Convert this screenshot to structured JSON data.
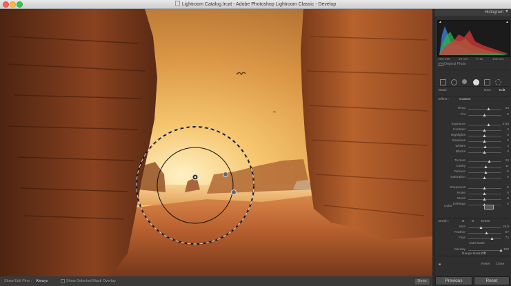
{
  "window": {
    "title": "Lightroom Catalog.lrcat - Adobe Photoshop Lightroom Classic - Develop"
  },
  "histogram": {
    "header": "Histogram",
    "iso": "ISO 100",
    "focal": "18 mm",
    "aperture": "f / 16",
    "shutter": "1/30 sec",
    "original_photo": "Original Photo"
  },
  "mask": {
    "label": "Mask :",
    "new": "New",
    "edit": "Edit"
  },
  "effect": {
    "label": "Effect :",
    "value": "Custom"
  },
  "sliders": [
    {
      "label": "Temp",
      "value": "13",
      "pos": 0.62
    },
    {
      "label": "Tint",
      "value": "0",
      "pos": 0.5
    },
    {
      "label": "Exposure",
      "value": "0.85",
      "pos": 0.62
    },
    {
      "label": "Contrast",
      "value": "0",
      "pos": 0.5
    },
    {
      "label": "Highlights",
      "value": "0",
      "pos": 0.5
    },
    {
      "label": "Shadows",
      "value": "0",
      "pos": 0.5
    },
    {
      "label": "Whites",
      "value": "4",
      "pos": 0.52
    },
    {
      "label": "Blacks",
      "value": "0",
      "pos": 0.5
    },
    {
      "label": "Texture",
      "value": "28",
      "pos": 0.64
    },
    {
      "label": "Clarity",
      "value": "11",
      "pos": 0.55
    },
    {
      "label": "Dehaze",
      "value": "8",
      "pos": 0.54
    },
    {
      "label": "Saturation",
      "value": "0",
      "pos": 0.5
    },
    {
      "label": "Sharpness",
      "value": "0",
      "pos": 0.5
    },
    {
      "label": "Noise",
      "value": "0",
      "pos": 0.5
    },
    {
      "label": "Moiré",
      "value": "0",
      "pos": 0.5
    },
    {
      "label": "Defringe",
      "value": "0",
      "pos": 0.5
    }
  ],
  "color": {
    "label": "Color"
  },
  "brush": {
    "label": "Brush :",
    "a": "A",
    "b": "B",
    "erase": "Erase",
    "size_label": "Size",
    "size_value": "19.0",
    "size_pos": 0.4,
    "feather_label": "Feather",
    "feather_value": "57",
    "feather_pos": 0.57,
    "flow_label": "Flow",
    "flow_value": "72",
    "flow_pos": 0.72,
    "auto_mask": "Auto Mask",
    "density_label": "Density",
    "density_value": "100",
    "density_pos": 1.0
  },
  "range_mask": {
    "label": "Range Mask :",
    "value": "Off"
  },
  "panel_footer": {
    "reset": "Reset",
    "close": "Close"
  },
  "buttons": {
    "previous": "Previous",
    "reset": "Reset",
    "done": "Done"
  },
  "bottombar": {
    "show_edit_pins_label": "Show Edit Pins :",
    "show_edit_pins_value": "Always",
    "show_overlay": "Show Selected Mask Overlay"
  }
}
